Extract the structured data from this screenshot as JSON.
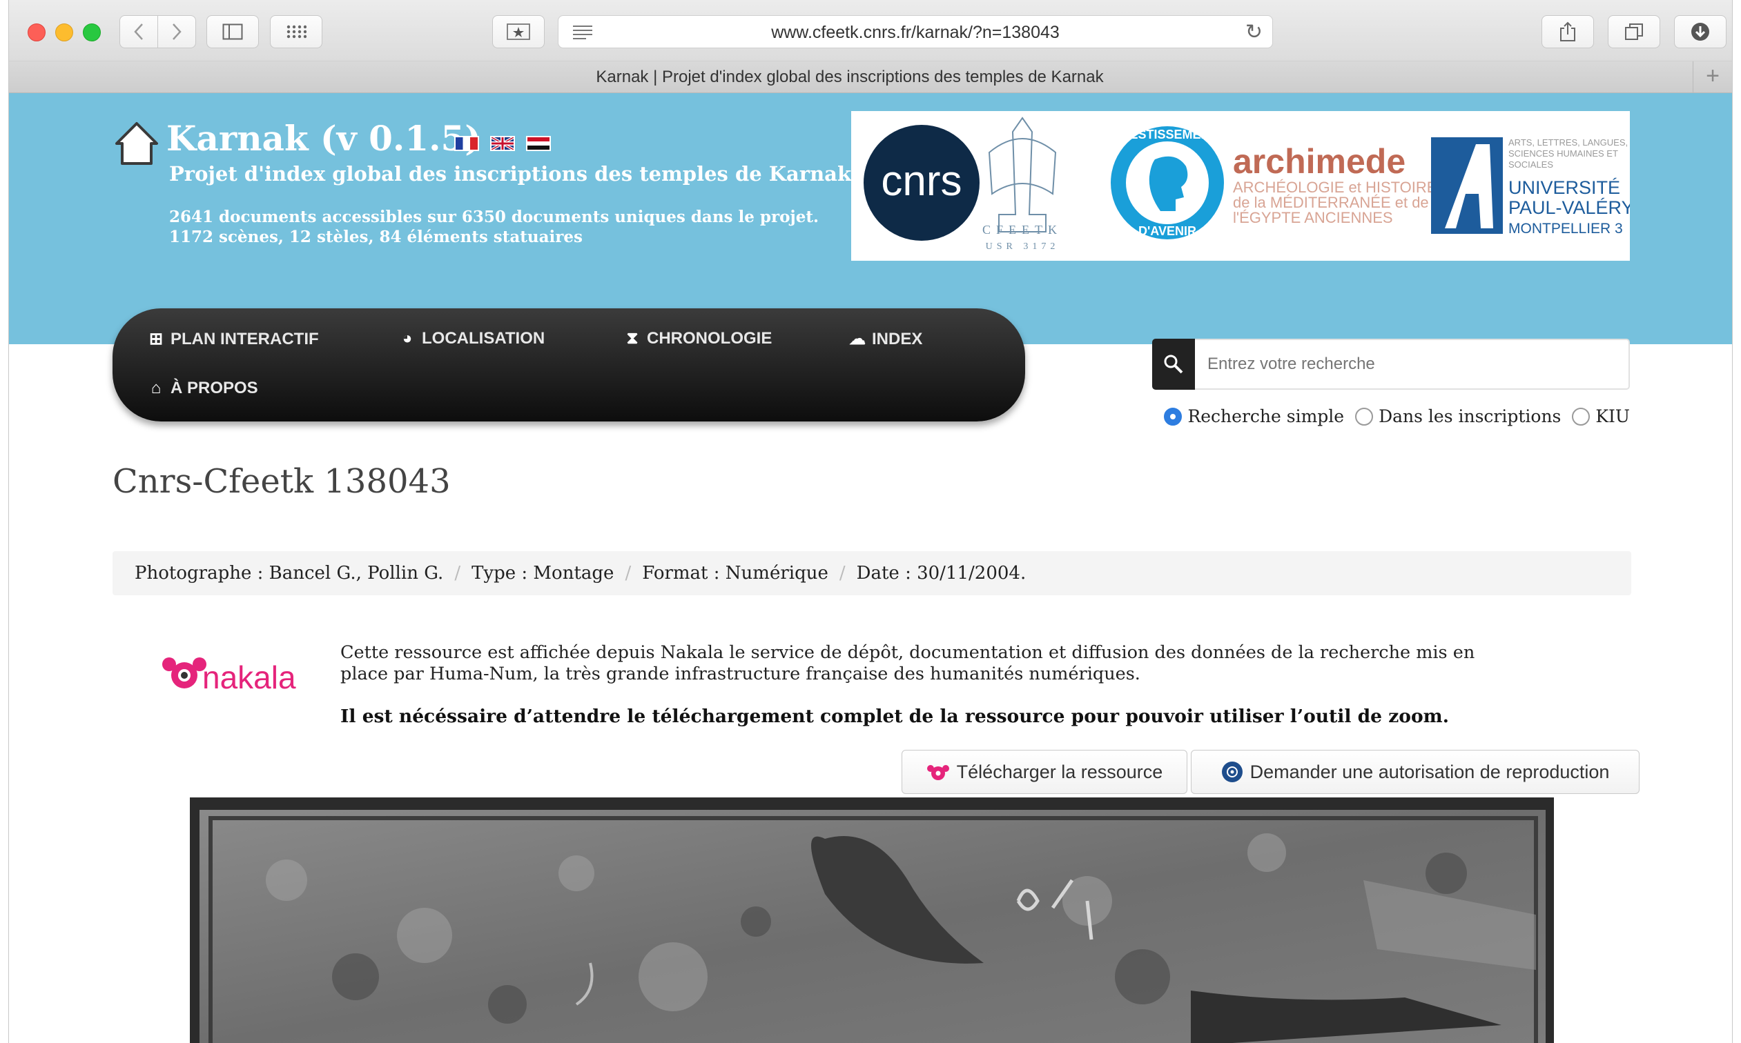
{
  "browser": {
    "url": "www.cfeetk.cnrs.fr/karnak/?n=138043",
    "tab_title": "Karnak | Projet d'index global des inscriptions des temples de Karnak",
    "new_tab_label": "+",
    "reload_glyph": "↻"
  },
  "header": {
    "title": "Karnak (v 0.1.5)",
    "subtitle": "Projet d'index global des inscriptions des temples de Karnak",
    "stats_line1": "2641 documents accessibles sur 6350 documents uniques dans le projet.",
    "stats_line2": "1172 scènes, 12 stèles, 84 éléments statuaires",
    "flags": [
      "fr-flag",
      "uk-flag",
      "eg-flag"
    ]
  },
  "logos": {
    "cnrs": "cnrs",
    "cfeetk_line1": "CFEETK",
    "cfeetk_line2": "USR 3172",
    "invest_top": "INVESTISSEMENTS",
    "invest_bottom": "D'AVENIR",
    "archimede": "archimede",
    "archimede_sub1": "ARCHÉOLOGIE et HISTOIRE",
    "archimede_sub2": "de la MÉDITERRANÉE et de",
    "archimede_sub3": "l'ÉGYPTE ANCIENNES",
    "upv_small1": "ARTS, LETTRES, LANGUES,",
    "upv_small2": "SCIENCES HUMAINES ET",
    "upv_small3": "SOCIALES",
    "upv_1": "UNIVERSITÉ",
    "upv_2": "PAUL-VALÉRY",
    "upv_3": "MONTPELLIER 3"
  },
  "nav": {
    "plan": "PLAN INTERACTIF",
    "localisation": "LOCALISATION",
    "chronologie": "CHRONOLOGIE",
    "index": "INDEX",
    "apropos": "À PROPOS"
  },
  "search": {
    "placeholder": "Entrez votre recherche",
    "options": [
      "Recherche simple",
      "Dans les inscriptions",
      "KIU"
    ],
    "selected": "Recherche simple"
  },
  "document": {
    "title": "Cnrs-Cfeetk 138043",
    "photographe": "Photographe : Bancel G., Pollin G.",
    "type": "Type : Montage",
    "format": "Format : Numérique",
    "date": "Date : 30/11/2004."
  },
  "nakala": {
    "logo_text": "nakala",
    "description": "Cette ressource est affichée depuis Nakala le service de dépôt, documentation et diffusion des données de la recherche mis en place par Huma-Num, la très grande infrastructure française des humanités numériques.",
    "warning": "Il est nécéssaire d’attendre le téléchargement complet de la ressource pour pouvoir utiliser l’outil de zoom."
  },
  "actions": {
    "download": "Télécharger la ressource",
    "request": "Demander une autorisation de reproduction"
  },
  "colors": {
    "banner": "#76c1dd",
    "navbar": "#1a1a1a",
    "nakala_pink": "#e5247b",
    "radio_selected": "#2d7de0"
  }
}
